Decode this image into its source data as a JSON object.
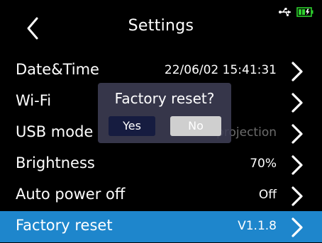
{
  "header": {
    "title": "Settings",
    "back_icon": "chevron-left-icon",
    "usb_icon": "usb-icon",
    "battery_icon": "battery-charging-icon"
  },
  "rows": [
    {
      "label": "Date&Time",
      "value": "22/06/02 15:41:31"
    },
    {
      "label": "Wi-Fi",
      "value": ""
    },
    {
      "label": "USB mode",
      "value": "USB projection"
    },
    {
      "label": "Brightness",
      "value": "70%"
    },
    {
      "label": "Auto power off",
      "value": "Off"
    },
    {
      "label": "Factory reset",
      "value": "V1.1.8",
      "selected": true
    }
  ],
  "dialog": {
    "question": "Factory reset?",
    "yes_label": "Yes",
    "no_label": "No"
  },
  "colors": {
    "background": "#000000",
    "selected_row": "#1e86cc",
    "battery": "#2ed12e",
    "dialog_bg": "#3e3e54",
    "yes_bg": "#161c40",
    "no_bg": "#cfcfcf"
  }
}
